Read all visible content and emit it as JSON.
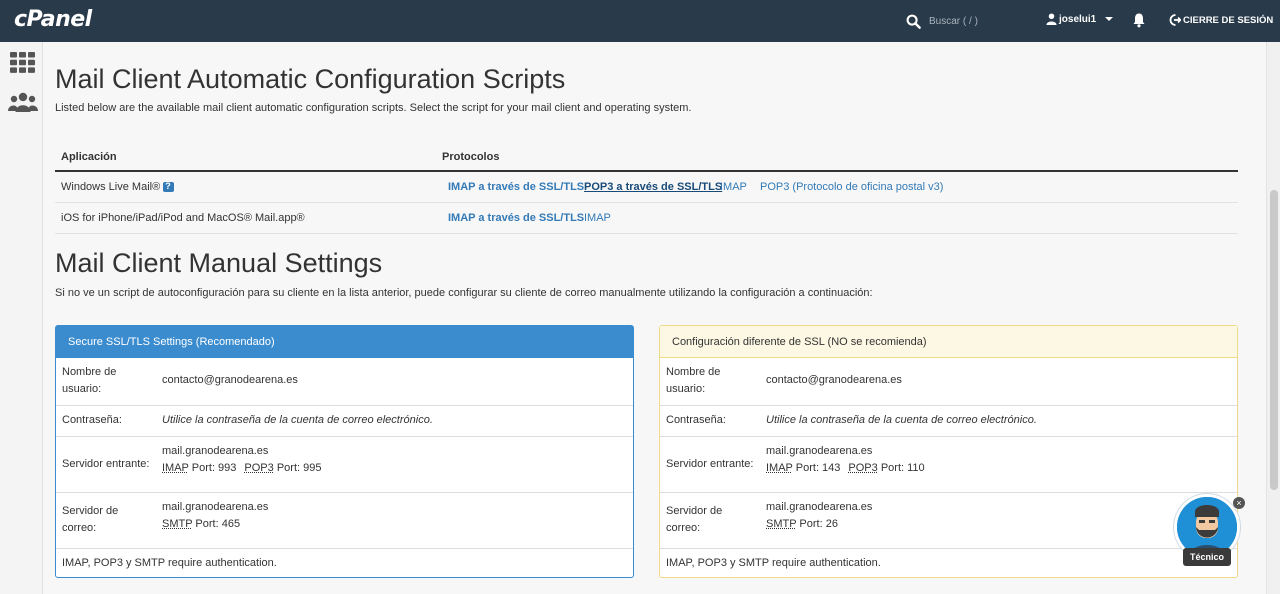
{
  "topbar": {
    "logo": "cPanel",
    "search_placeholder": "Buscar ( / )",
    "username": "joselui1",
    "logout_label": "CIERRE DE SESIÓN"
  },
  "auto": {
    "title": "Mail Client Automatic Configuration Scripts",
    "description": "Listed below are the available mail client automatic configuration scripts. Select the script for your mail client and operating system.",
    "col_app": "Aplicación",
    "col_protocols": "Protocolos",
    "rows": [
      {
        "app": "Windows Live Mail®",
        "protocols": [
          "IMAP a través de SSL/TLS",
          "POP3 a través de SSL/TLS",
          "IMAP",
          "POP3 (Protocolo de oficina postal v3)"
        ]
      },
      {
        "app": "iOS for iPhone/iPad/iPod and MacOS® Mail.app®",
        "protocols": [
          "IMAP a través de SSL/TLS",
          "IMAP"
        ]
      }
    ]
  },
  "manual": {
    "title": "Mail Client Manual Settings",
    "description": "Si no ve un script de autoconfiguración para su cliente en la lista anterior, puede configurar su cliente de correo manualmente utilizando la configuración a continuación:"
  },
  "secure_panel": {
    "heading": "Secure SSL/TLS Settings (Recomendado)",
    "username_label_1": "Nombre de",
    "username_label_2": "usuario:",
    "username": "contacto@granodearena.es",
    "password_label": "Contraseña:",
    "password_value": "Utilice la contraseña de la cuenta de correo electrónico.",
    "incoming_label": "Servidor entrante:",
    "incoming_host": "mail.granodearena.es",
    "imap": "IMAP",
    "imap_port": "Port: 993",
    "pop3": "POP3",
    "pop3_port": "Port: 995",
    "outgoing_label_1": "Servidor de",
    "outgoing_label_2": "correo:",
    "outgoing_host": "mail.granodearena.es",
    "smtp": "SMTP",
    "smtp_port": "Port: 465",
    "auth_note": "IMAP, POP3 y SMTP require authentication."
  },
  "nonssl_panel": {
    "heading": "Configuración diferente de SSL (NO se recomienda)",
    "username_label_1": "Nombre de",
    "username_label_2": "usuario:",
    "username": "contacto@granodearena.es",
    "password_label": "Contraseña:",
    "password_value": "Utilice la contraseña de la cuenta de correo electrónico.",
    "incoming_label": "Servidor entrante:",
    "incoming_host": "mail.granodearena.es",
    "imap": "IMAP",
    "imap_port": "Port: 143",
    "pop3": "POP3",
    "pop3_port": "Port: 110",
    "outgoing_label_1": "Servidor de",
    "outgoing_label_2": "correo:",
    "outgoing_host": "mail.granodearena.es",
    "smtp": "SMTP",
    "smtp_port": "Port: 26",
    "auth_note": "IMAP, POP3 y SMTP require authentication."
  },
  "chat_widget": {
    "label": "Técnico",
    "close": "×"
  },
  "icons": {
    "search": "search-icon",
    "user": "user-icon",
    "bell": "bell-icon",
    "logout": "logout-icon",
    "grid": "grid-icon",
    "users": "users-icon",
    "info": "info-icon"
  },
  "colors": {
    "topbar": "#293a4a",
    "link": "#337ab7",
    "primary_panel": "#3a8ccf",
    "warning_panel": "#fcf8e3"
  }
}
